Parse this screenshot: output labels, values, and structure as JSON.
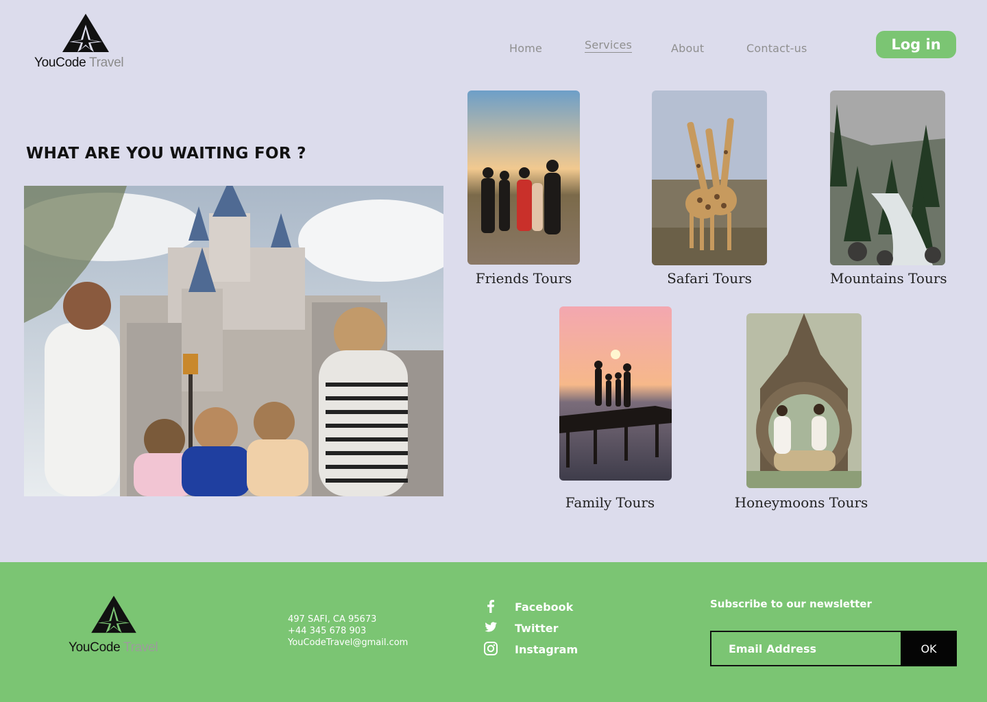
{
  "header": {
    "logo": {
      "brand_main": "YouCode",
      "brand_accent": "Travel",
      "icon": "plane-mountain-logo-icon"
    },
    "nav": [
      {
        "label": "Home",
        "active": false
      },
      {
        "label": "Services",
        "active": true
      },
      {
        "label": "About",
        "active": false
      },
      {
        "label": "Contact-us",
        "active": false
      }
    ],
    "login_label": "Log in"
  },
  "hero": {
    "title": "WHAT ARE YOU WAITING FOR ?",
    "image": "family-at-castle-photo"
  },
  "tours": [
    {
      "label": "Friends Tours",
      "image": "friends-sunset-photo"
    },
    {
      "label": "Safari Tours",
      "image": "giraffes-photo"
    },
    {
      "label": "Mountains Tours",
      "image": "mountain-river-photo"
    },
    {
      "label": "Family Tours",
      "image": "family-pier-sunset-photo"
    },
    {
      "label": "Honeymoons Tours",
      "image": "couple-nest-photo"
    }
  ],
  "footer": {
    "logo": {
      "brand_main": "YouCode",
      "brand_accent": "Travel"
    },
    "contact": {
      "address": "497  SAFI, CA 95673",
      "phone": "+44 345 678 903",
      "email": "YouCodeTravel@gmail.com"
    },
    "social": [
      {
        "label": "Facebook",
        "icon": "facebook-icon"
      },
      {
        "label": "Twitter",
        "icon": "twitter-icon"
      },
      {
        "label": "Instagram",
        "icon": "instagram-icon"
      }
    ],
    "newsletter": {
      "title": "Subscribe to our newsletter",
      "placeholder": "Email Address",
      "button_label": "OK"
    }
  },
  "colors": {
    "background": "#dcdcec",
    "accent_green": "#7bc573",
    "text_dark": "#111111",
    "nav_gray": "#8f8f8f"
  }
}
